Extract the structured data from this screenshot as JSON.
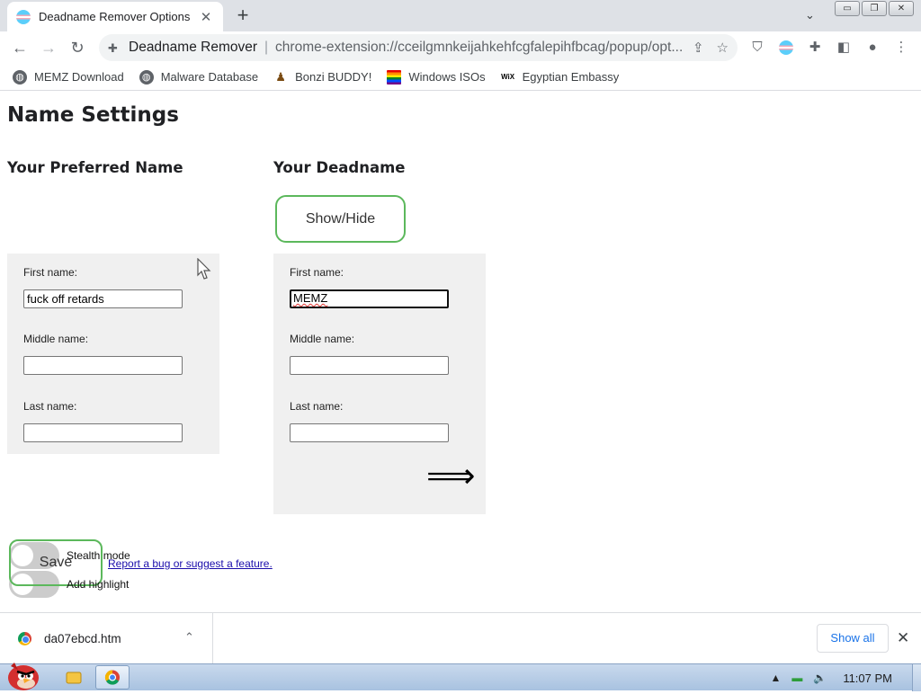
{
  "browser": {
    "tab_title": "Deadname Remover Options",
    "tab_close": "✕",
    "new_tab": "+",
    "tab_search": "⌄",
    "window_buttons": [
      "▭",
      "❐",
      "✕"
    ],
    "omnibox": {
      "site_name": "Deadname Remover",
      "separator": "|",
      "url": "chrome-extension://cceilgmnkeijahkehfcgfalepihfbcag/popup/opt..."
    },
    "bookmarks": [
      {
        "label": "MEMZ Download",
        "icon": "globe-icon"
      },
      {
        "label": "Malware Database",
        "icon": "globe-icon"
      },
      {
        "label": "Bonzi BUDDY!",
        "icon": "bonzi-icon"
      },
      {
        "label": "Windows ISOs",
        "icon": "rainbow-flag-icon"
      },
      {
        "label": "Egyptian Embassy",
        "icon": "wix-icon"
      }
    ]
  },
  "page": {
    "title": "Name Settings",
    "preferred": {
      "heading": "Your Preferred Name",
      "first_label": "First name:",
      "first_value": "fuck off retards",
      "middle_label": "Middle name:",
      "middle_value": "",
      "last_label": "Last name:",
      "last_value": ""
    },
    "deadname": {
      "heading": "Your Deadname",
      "show_hide_label": "Show/Hide",
      "first_label": "First name:",
      "first_value": "MEMZ",
      "middle_label": "Middle name:",
      "middle_value": "",
      "last_label": "Last name:",
      "last_value": "",
      "arrow": "⟹"
    },
    "save_label": "Save",
    "toggles": [
      {
        "label": "Stealth mode",
        "on": false
      },
      {
        "label": "Add highlight",
        "on": false
      }
    ],
    "report_link": "Report a bug or suggest a feature."
  },
  "downloads": {
    "file_name": "da07ebcd.htm",
    "chevron": "⌃",
    "show_all": "Show all",
    "close": "✕"
  },
  "taskbar": {
    "clock": "11:07 PM"
  },
  "colors": {
    "accent_green": "#5cb85c",
    "panel_bg": "#f0f0f0",
    "link": "#1a0dab"
  }
}
